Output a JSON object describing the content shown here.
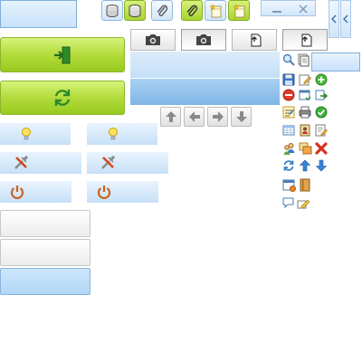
{
  "icons": {
    "toolbar": [
      "stack-icon",
      "stack-green-icon",
      "paperclip-icon",
      "paperclip-green-icon",
      "new-document-icon",
      "new-document-green-icon"
    ],
    "camera": [
      "camera-icon",
      "camera-icon"
    ],
    "paste": [
      "paste-icon",
      "paste-icon"
    ],
    "arrows": [
      "arrow-up-icon",
      "arrow-left-icon",
      "arrow-right-icon",
      "arrow-down-icon"
    ],
    "grid": [
      [
        "save-icon",
        "edit-icon",
        "add-icon"
      ],
      [
        "delete-icon",
        "window-icon",
        "export-icon"
      ],
      [
        "check-list-icon",
        "print-icon",
        "ok-icon"
      ],
      [
        "table-icon",
        "contact-icon",
        "note-edit-icon"
      ],
      [
        "users-icon",
        "transfer-icon",
        "remove-icon"
      ],
      [
        "refresh-icon",
        "up-icon",
        "down-icon"
      ],
      [
        "calendar-icon",
        "book-icon"
      ],
      [
        "comment-icon",
        "pencil-icon"
      ]
    ]
  },
  "colors": {
    "green_accent": "#a4d233",
    "blue_accent": "#7fb6e6",
    "power_orange": "#c8641e"
  }
}
